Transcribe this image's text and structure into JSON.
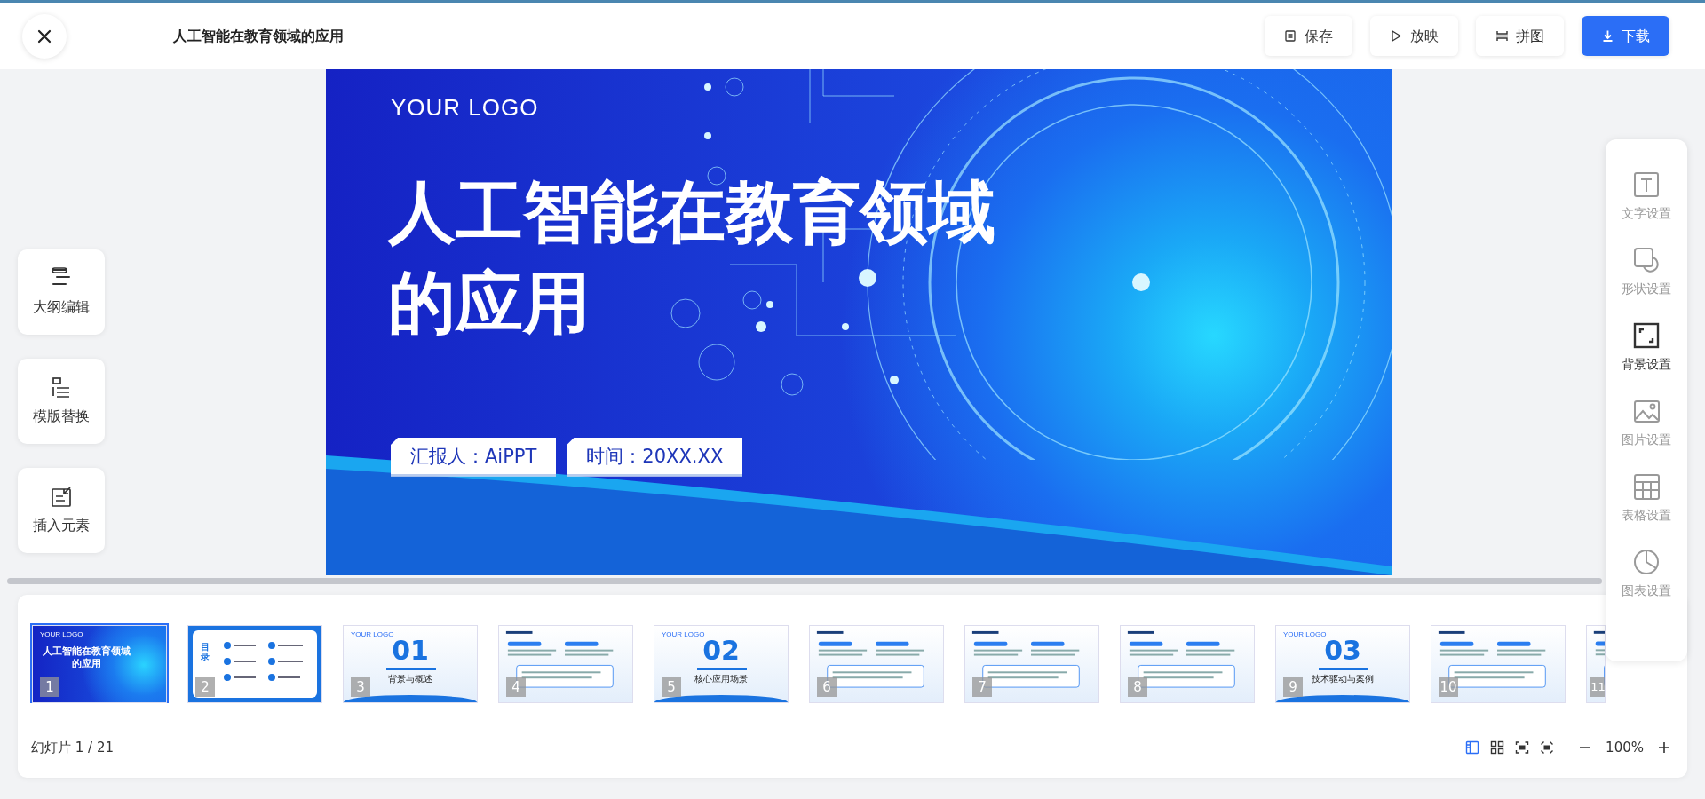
{
  "header": {
    "title": "人工智能在教育领域的应用",
    "buttons": [
      {
        "kind": "save",
        "label": "保存",
        "primary": false
      },
      {
        "kind": "play",
        "label": "放映",
        "primary": false
      },
      {
        "kind": "puzzle",
        "label": "拼图",
        "primary": false
      },
      {
        "kind": "download",
        "label": "下载",
        "primary": true
      }
    ]
  },
  "left_tools": [
    {
      "kind": "outline",
      "label": "大纲编辑"
    },
    {
      "kind": "template",
      "label": "模版替换"
    },
    {
      "kind": "insert",
      "label": "插入元素"
    }
  ],
  "slide": {
    "logo": "YOUR LOGO",
    "title": "人工智能在教育领域的应用",
    "tags": [
      "汇报人：AiPPT",
      "时间：20XX.XX"
    ]
  },
  "right_panel": [
    {
      "kind": "text",
      "label": "文字设置",
      "selected": false
    },
    {
      "kind": "shape",
      "label": "形状设置",
      "selected": false
    },
    {
      "kind": "background",
      "label": "背景设置",
      "selected": true
    },
    {
      "kind": "image",
      "label": "图片设置",
      "selected": false
    },
    {
      "kind": "table",
      "label": "表格设置",
      "selected": false
    },
    {
      "kind": "chart",
      "label": "图表设置",
      "selected": false
    }
  ],
  "thumbnails": [
    {
      "number": "1",
      "kind": "cover",
      "selected": true,
      "logo": "YOUR LOGO",
      "title": "人工智能在教育领域的应用"
    },
    {
      "number": "2",
      "kind": "toc",
      "selected": false,
      "heading": "目录"
    },
    {
      "number": "3",
      "kind": "section",
      "selected": false,
      "logo": "YOUR LOGO",
      "index": "01",
      "title": "背景与概述"
    },
    {
      "number": "4",
      "kind": "content",
      "selected": false
    },
    {
      "number": "5",
      "kind": "section",
      "selected": false,
      "logo": "YOUR LOGO",
      "index": "02",
      "title": "核心应用场景"
    },
    {
      "number": "6",
      "kind": "content",
      "selected": false
    },
    {
      "number": "7",
      "kind": "content",
      "selected": false
    },
    {
      "number": "8",
      "kind": "content",
      "selected": false
    },
    {
      "number": "9",
      "kind": "section",
      "selected": false,
      "logo": "YOUR LOGO",
      "index": "03",
      "title": "技术驱动与案例"
    },
    {
      "number": "10",
      "kind": "content",
      "selected": false
    },
    {
      "number": "11",
      "kind": "content",
      "selected": false
    }
  ],
  "footer": {
    "counter": "幻灯片  1 / 21",
    "views": [
      {
        "kind": "list",
        "selected": true
      },
      {
        "kind": "grid",
        "selected": false
      },
      {
        "kind": "fit",
        "selected": false
      },
      {
        "kind": "fullscreen",
        "selected": false
      }
    ],
    "zoom": "100%"
  }
}
